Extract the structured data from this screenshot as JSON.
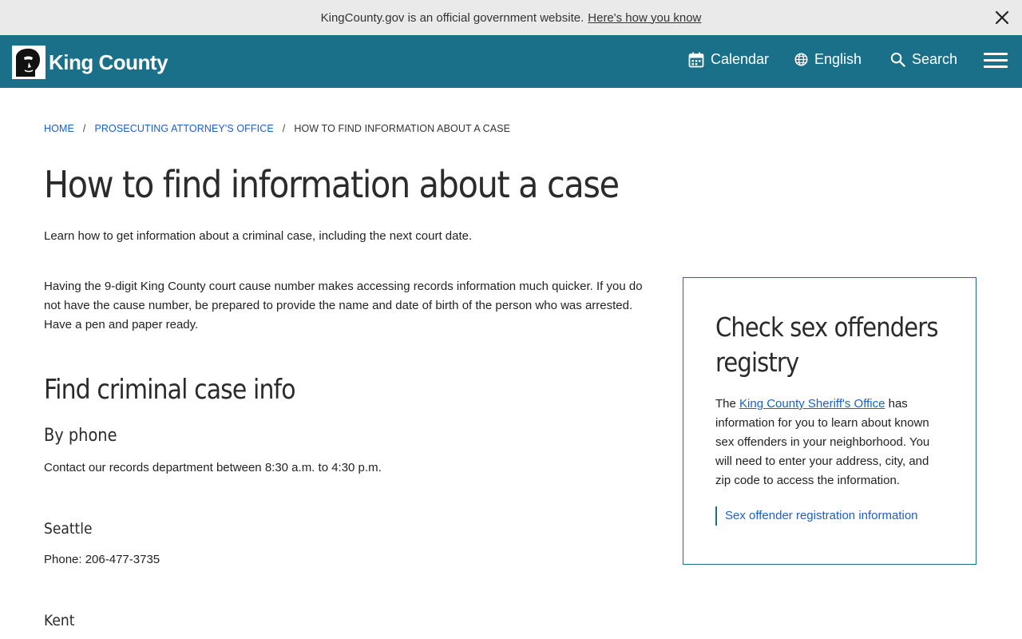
{
  "gov_banner": {
    "text": "KingCounty.gov is an official government website.",
    "link": "Here's how you know",
    "close_icon": "close-icon"
  },
  "header": {
    "logo_text": "King County",
    "calendar": "Calendar",
    "language": "English",
    "search": "Search",
    "menu_icon": "hamburger-menu-icon",
    "colors": {
      "bar": "#1b7089",
      "text": "#ffffff"
    }
  },
  "breadcrumb": {
    "home": "HOME",
    "office": "PROSECUTING ATTORNEY'S OFFICE",
    "current": "HOW TO FIND INFORMATION ABOUT A CASE",
    "separator": "/"
  },
  "main": {
    "title": "How to find information about a case",
    "lead": "Learn how to get information about a criminal case, including the next court date.",
    "intro": "Having the 9-digit King County court cause number makes accessing records information much quicker. If you do not have the cause number, be prepared to provide the name and date of birth of the person who was arrested. Have a pen and paper ready.",
    "section_heading": "Find criminal case info",
    "by_phone_heading": "By phone",
    "by_phone_text": "Contact our records department between 8:30 a.m. to 4:30 p.m.",
    "seattle_heading": "Seattle",
    "seattle_phone": "Phone: 206-477-3735",
    "kent_heading": "Kent"
  },
  "sidebar_card": {
    "title": "Check sex offenders registry",
    "body_prefix": "The",
    "body_link": "King County Sheriff's Office",
    "body_suffix": "has information for you to learn about known sex offenders in your neighborhood. You will need to enter your address, city, and zip code to access the information.",
    "cta": "Sex offender registration information",
    "border_color": "#1b7089"
  },
  "link_color": "#1d5fc9"
}
